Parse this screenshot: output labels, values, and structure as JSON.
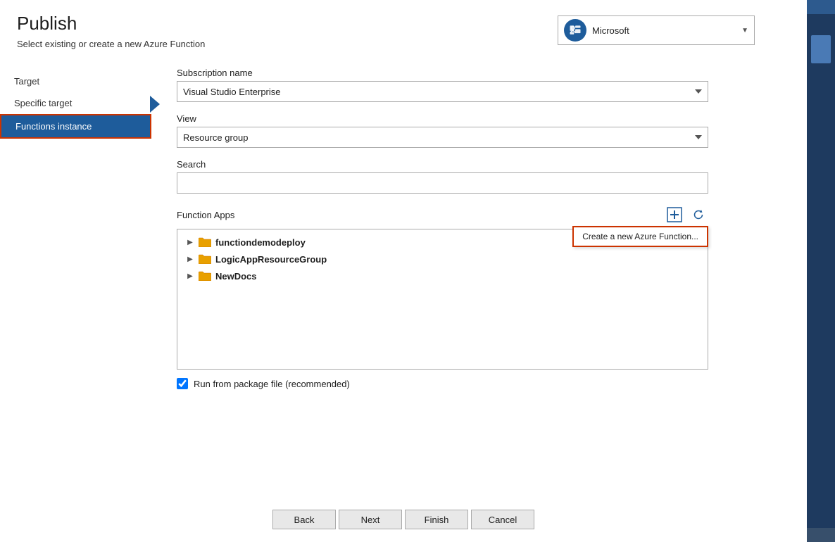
{
  "header": {
    "title": "Publish",
    "subtitle": "Select existing or create a new Azure Function"
  },
  "account": {
    "name": "Microsoft",
    "icon_label": "microsoft-icon"
  },
  "nav": {
    "items": [
      {
        "id": "target",
        "label": "Target",
        "active": false
      },
      {
        "id": "specific-target",
        "label": "Specific target",
        "active": false
      },
      {
        "id": "functions-instance",
        "label": "Functions instance",
        "active": true
      }
    ]
  },
  "form": {
    "subscription_label": "Subscription name",
    "subscription_value": "Visual Studio Enterprise",
    "view_label": "View",
    "view_value": "Resource group",
    "search_label": "Search",
    "search_placeholder": ""
  },
  "function_apps": {
    "label": "Function Apps",
    "add_tooltip": "Create a new Azure Function...",
    "refresh_label": "Refresh",
    "items": [
      {
        "name": "functiondemodeploy"
      },
      {
        "name": "LogicAppResourceGroup"
      },
      {
        "name": "NewDocs"
      }
    ]
  },
  "checkbox": {
    "label": "Run from package file (recommended)",
    "checked": true
  },
  "buttons": {
    "back": "Back",
    "next": "Next",
    "finish": "Finish",
    "cancel": "Cancel"
  }
}
